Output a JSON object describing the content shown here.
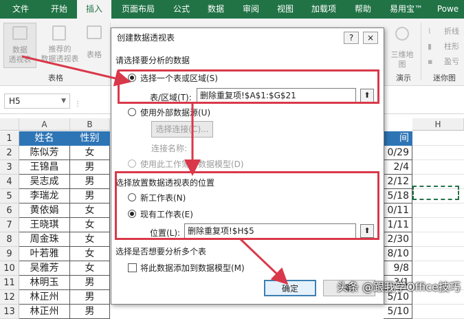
{
  "ribbon": {
    "tabs": [
      "文件",
      "开始",
      "插入",
      "页面布局",
      "公式",
      "数据",
      "审阅",
      "视图",
      "加载项",
      "帮助",
      "易用宝™",
      "Powe"
    ],
    "active_tab": "插入",
    "buttons": {
      "pivot": [
        "数据",
        "透视表"
      ],
      "recommended_pivot": [
        "推荐的",
        "数据透视表"
      ],
      "table": "表格",
      "map3d": [
        "三维地",
        "图"
      ],
      "spark_line": "折线",
      "spark_column": "柱形",
      "spark_winloss": "盈亏"
    },
    "groups": {
      "tables": "表格",
      "demo": "演示",
      "sparklines": "迷你图"
    }
  },
  "formula_bar": {
    "name_box": "H5"
  },
  "sheet": {
    "columns": [
      "A",
      "B",
      "H"
    ],
    "rows": [
      "1",
      "2",
      "3",
      "4",
      "5",
      "6",
      "7",
      "8",
      "9",
      "10",
      "11",
      "12",
      "13"
    ],
    "header": [
      "姓名",
      "性别",
      "间"
    ],
    "data": [
      [
        "陈似芳",
        "女",
        "0/29"
      ],
      [
        "王锦昌",
        "男",
        "2/4"
      ],
      [
        "吴志成",
        "男",
        "2/12"
      ],
      [
        "李瑞龙",
        "男",
        "5/18"
      ],
      [
        "黄依娟",
        "女",
        "0/11"
      ],
      [
        "王晓琪",
        "女",
        "1/11"
      ],
      [
        "周金珠",
        "女",
        "2/30"
      ],
      [
        "叶若雅",
        "女",
        "8/10"
      ],
      [
        "吴雅芳",
        "女",
        "9/8"
      ],
      [
        "林明玉",
        "男",
        "3/1"
      ],
      [
        "林正州",
        "男",
        "5/10"
      ],
      [
        "林正州",
        "男",
        "5/10"
      ]
    ]
  },
  "dialog": {
    "title": "创建数据透视表",
    "help": "?",
    "close": "×",
    "section1": "请选择要分析的数据",
    "opt_table": "选择一个表或区域(S)",
    "range_label": "表/区域(T):",
    "range_value": "删除重复项!$A$1:$G$21",
    "opt_external": "使用外部数据源(U)",
    "choose_conn": "选择连接(C)...",
    "conn_name": "连接名称:",
    "opt_model": "使用此工作簿的数据模型(D)",
    "section2": "选择放置数据透视表的位置",
    "opt_new": "新工作表(N)",
    "opt_existing": "现有工作表(E)",
    "loc_label": "位置(L):",
    "loc_value": "删除重复项!$H$5",
    "section3": "选择是否想要分析多个表",
    "add_model": "将此数据添加到数据模型(M)",
    "ok": "确定",
    "cancel": "取",
    "pick_icon": "range-picker-icon"
  },
  "watermark": "头条 @跟我学Office技巧",
  "colors": {
    "excel_green": "#217346",
    "header_blue": "#2e75b6",
    "annotation_red": "#d9384a"
  }
}
